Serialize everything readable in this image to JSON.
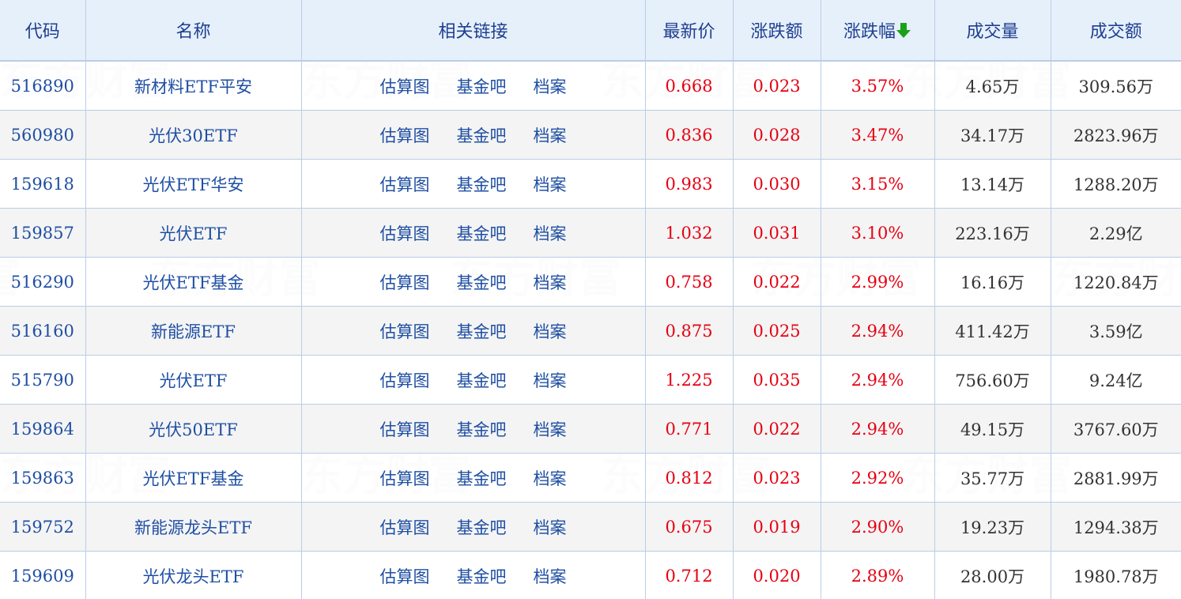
{
  "headers": {
    "code": "代码",
    "name": "名称",
    "links": "相关链接",
    "price": "最新价",
    "change": "涨跌额",
    "pct": "涨跌幅",
    "volume": "成交量",
    "amount": "成交额"
  },
  "sort": {
    "column": "pct",
    "direction": "desc",
    "icon": "arrow-down-icon",
    "color": "#1aa11a"
  },
  "link_labels": {
    "chart": "估算图",
    "forum": "基金吧",
    "profile": "档案"
  },
  "colors": {
    "up": "#e60012",
    "link": "#1f4fa3",
    "header_bg": "#e6f0fb",
    "border": "#b9cde7"
  },
  "watermark": "东方财富",
  "rows": [
    {
      "code": "516890",
      "name": "新材料ETF平安",
      "price": "0.668",
      "change": "0.023",
      "pct": "3.57%",
      "volume": "4.65万",
      "amount": "309.56万"
    },
    {
      "code": "560980",
      "name": "光伏30ETF",
      "price": "0.836",
      "change": "0.028",
      "pct": "3.47%",
      "volume": "34.17万",
      "amount": "2823.96万"
    },
    {
      "code": "159618",
      "name": "光伏ETF华安",
      "price": "0.983",
      "change": "0.030",
      "pct": "3.15%",
      "volume": "13.14万",
      "amount": "1288.20万"
    },
    {
      "code": "159857",
      "name": "光伏ETF",
      "price": "1.032",
      "change": "0.031",
      "pct": "3.10%",
      "volume": "223.16万",
      "amount": "2.29亿"
    },
    {
      "code": "516290",
      "name": "光伏ETF基金",
      "price": "0.758",
      "change": "0.022",
      "pct": "2.99%",
      "volume": "16.16万",
      "amount": "1220.84万"
    },
    {
      "code": "516160",
      "name": "新能源ETF",
      "price": "0.875",
      "change": "0.025",
      "pct": "2.94%",
      "volume": "411.42万",
      "amount": "3.59亿"
    },
    {
      "code": "515790",
      "name": "光伏ETF",
      "price": "1.225",
      "change": "0.035",
      "pct": "2.94%",
      "volume": "756.60万",
      "amount": "9.24亿"
    },
    {
      "code": "159864",
      "name": "光伏50ETF",
      "price": "0.771",
      "change": "0.022",
      "pct": "2.94%",
      "volume": "49.15万",
      "amount": "3767.60万"
    },
    {
      "code": "159863",
      "name": "光伏ETF基金",
      "price": "0.812",
      "change": "0.023",
      "pct": "2.92%",
      "volume": "35.77万",
      "amount": "2881.99万"
    },
    {
      "code": "159752",
      "name": "新能源龙头ETF",
      "price": "0.675",
      "change": "0.019",
      "pct": "2.90%",
      "volume": "19.23万",
      "amount": "1294.38万"
    },
    {
      "code": "159609",
      "name": "光伏龙头ETF",
      "price": "0.712",
      "change": "0.020",
      "pct": "2.89%",
      "volume": "28.00万",
      "amount": "1980.78万"
    }
  ]
}
